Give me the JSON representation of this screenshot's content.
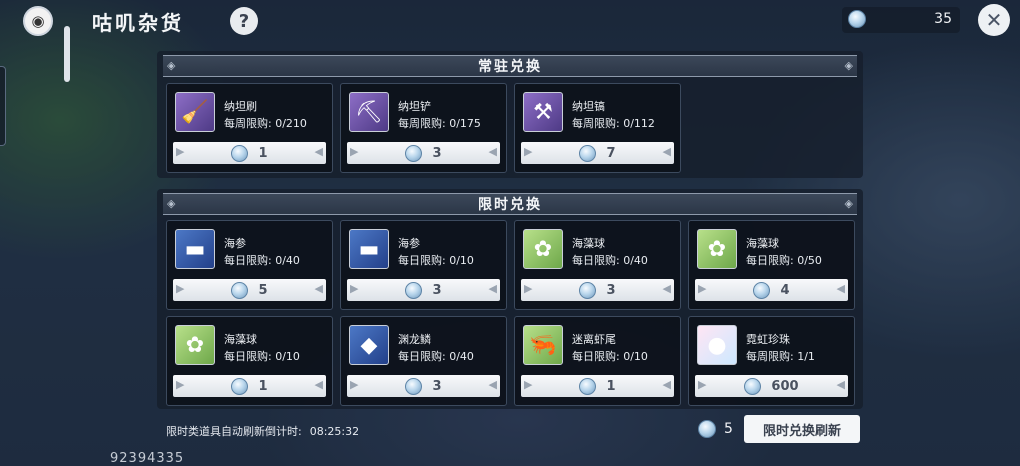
{
  "header": {
    "title": "咕叽杂货",
    "help_label": "?",
    "currency_count": "35",
    "close_label": "✕"
  },
  "regular_section": {
    "title": "常驻兑换",
    "items": [
      {
        "name": "纳坦刷",
        "limit": "每周限购: 0/210",
        "price": "1",
        "icon": "brush-icon"
      },
      {
        "name": "纳坦铲",
        "limit": "每周限购: 0/175",
        "price": "3",
        "icon": "shovel-icon"
      },
      {
        "name": "纳坦镐",
        "limit": "每周限购: 0/112",
        "price": "7",
        "icon": "pickaxe-icon"
      }
    ]
  },
  "limited_section": {
    "title": "限时兑换",
    "items": [
      {
        "name": "海参",
        "limit": "每日限购: 0/40",
        "price": "5",
        "icon": "sea-cucumber-icon"
      },
      {
        "name": "海参",
        "limit": "每日限购: 0/10",
        "price": "3",
        "icon": "sea-cucumber-icon"
      },
      {
        "name": "海藻球",
        "limit": "每日限购: 0/40",
        "price": "3",
        "icon": "seaweed-ball-icon"
      },
      {
        "name": "海藻球",
        "limit": "每日限购: 0/50",
        "price": "4",
        "icon": "seaweed-ball-icon"
      },
      {
        "name": "海藻球",
        "limit": "每日限购: 0/10",
        "price": "1",
        "icon": "seaweed-ball-icon"
      },
      {
        "name": "渊龙鳞",
        "limit": "每日限购: 0/40",
        "price": "3",
        "icon": "dragon-scale-icon"
      },
      {
        "name": "迷离虾尾",
        "limit": "每日限购: 0/10",
        "price": "1",
        "icon": "shrimp-tail-icon"
      },
      {
        "name": "霓虹珍珠",
        "limit": "每周限购: 1/1",
        "price": "600",
        "icon": "rainbow-pearl-icon"
      }
    ]
  },
  "footer": {
    "countdown_label": "限时类道具自动刷新倒计时:",
    "countdown_time": "08:25:32",
    "refresh_cost": "5",
    "refresh_button": "限时兑换刷新",
    "player_id": "92394335"
  }
}
